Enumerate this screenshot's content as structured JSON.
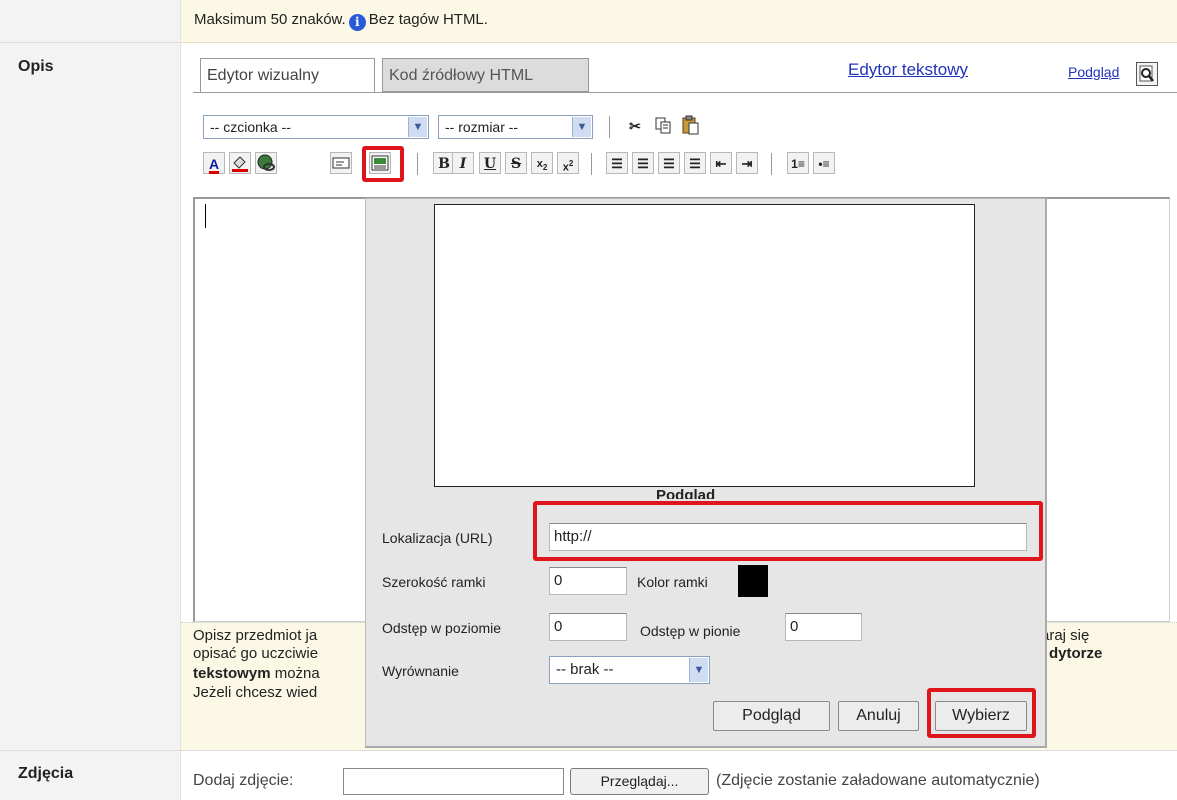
{
  "top_note": {
    "text1": "Maksimum 50 znaków.",
    "text2": "Bez tagów HTML."
  },
  "rows": {
    "opis": "Opis",
    "zdjecia": "Zdjęcia"
  },
  "tabs": {
    "visual": "Edytor wizualny",
    "html": "Kod źródłowy HTML",
    "text_editor": "Edytor tekstowy",
    "preview": "Podgląd"
  },
  "toolbar": {
    "font_select": "-- czcionka --",
    "size_select": "-- rozmiar --"
  },
  "hint": {
    "line1": "Opisz przedmiot ja",
    "line1_end": "araj się",
    "line2": "opisać go uczciwie",
    "line2_end": "dytorze",
    "line3_bold": "tekstowym",
    "line3": " można",
    "line4": "Jeżeli chcesz wied"
  },
  "dialog": {
    "preview_caption": "Podgląd",
    "url_label": "Lokalizacja (URL)",
    "url_value": "http://",
    "border_width_label": "Szerokość ramki",
    "border_width_value": "0",
    "border_color_label": "Kolor ramki",
    "border_color": "#000000",
    "hspace_label": "Odstęp w poziomie",
    "hspace_value": "0",
    "vspace_label": "Odstęp w pionie",
    "vspace_value": "0",
    "align_label": "Wyrównanie",
    "align_value": "-- brak --",
    "btn_preview": "Podgląd",
    "btn_cancel": "Anuluj",
    "btn_select": "Wybierz"
  },
  "photos": {
    "label": "Dodaj zdjęcie:",
    "browse": "Przeglądaj...",
    "note": "(Zdjęcie zostanie załadowane automatycznie)"
  },
  "colors": {
    "highlight": "#e0141b",
    "link": "#2233bb",
    "note_bg": "#fbf8e6"
  }
}
